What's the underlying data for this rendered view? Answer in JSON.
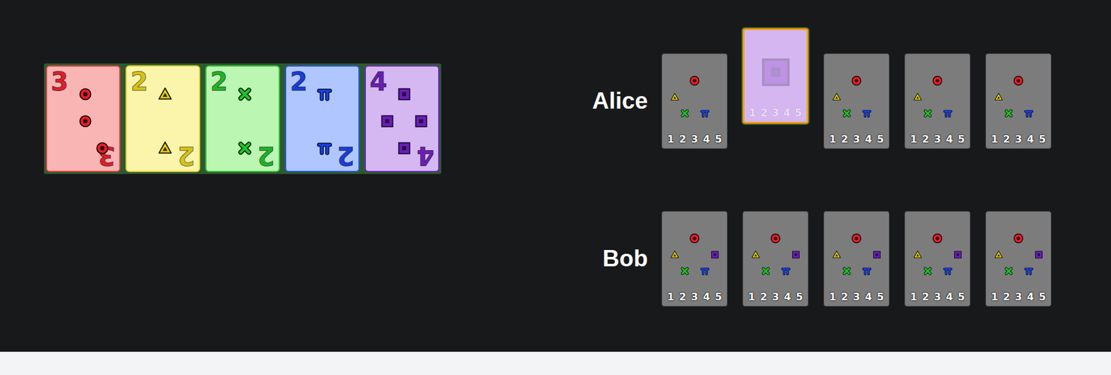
{
  "play_stacks": [
    {
      "suit": "red",
      "rank": "3",
      "color": "#d9202c"
    },
    {
      "suit": "yellow",
      "rank": "2",
      "color": "#d6c21a"
    },
    {
      "suit": "green",
      "rank": "2",
      "color": "#22b22a"
    },
    {
      "suit": "blue",
      "rank": "2",
      "color": "#1a3fd6"
    },
    {
      "suit": "purple",
      "rank": "4",
      "color": "#6a1fb3"
    }
  ],
  "players": [
    {
      "name": "Alice",
      "cards": [
        {
          "kind": "unknown",
          "selected": false,
          "possible_suits": [
            "red",
            "yellow",
            "green",
            "blue"
          ],
          "possible_ranks": [
            "1",
            "2",
            "3",
            "4",
            "5"
          ]
        },
        {
          "kind": "clued",
          "selected": true,
          "possible_suits": [
            "purple"
          ],
          "possible_ranks": [
            "1",
            "2",
            "3",
            "4",
            "5"
          ]
        },
        {
          "kind": "unknown",
          "selected": false,
          "possible_suits": [
            "red",
            "yellow",
            "green",
            "blue"
          ],
          "possible_ranks": [
            "1",
            "2",
            "3",
            "4",
            "5"
          ]
        },
        {
          "kind": "unknown",
          "selected": false,
          "possible_suits": [
            "red",
            "yellow",
            "green",
            "blue"
          ],
          "possible_ranks": [
            "1",
            "2",
            "3",
            "4",
            "5"
          ]
        },
        {
          "kind": "unknown",
          "selected": false,
          "possible_suits": [
            "red",
            "yellow",
            "green",
            "blue"
          ],
          "possible_ranks": [
            "1",
            "2",
            "3",
            "4",
            "5"
          ]
        }
      ]
    },
    {
      "name": "Bob",
      "cards": [
        {
          "kind": "unknown",
          "selected": false,
          "possible_suits": [
            "red",
            "yellow",
            "purple",
            "green",
            "blue"
          ],
          "possible_ranks": [
            "1",
            "2",
            "3",
            "4",
            "5"
          ]
        },
        {
          "kind": "unknown",
          "selected": false,
          "possible_suits": [
            "red",
            "yellow",
            "purple",
            "green",
            "blue"
          ],
          "possible_ranks": [
            "1",
            "2",
            "3",
            "4",
            "5"
          ]
        },
        {
          "kind": "unknown",
          "selected": false,
          "possible_suits": [
            "red",
            "yellow",
            "purple",
            "green",
            "blue"
          ],
          "possible_ranks": [
            "1",
            "2",
            "3",
            "4",
            "5"
          ]
        },
        {
          "kind": "unknown",
          "selected": false,
          "possible_suits": [
            "red",
            "yellow",
            "purple",
            "green",
            "blue"
          ],
          "possible_ranks": [
            "1",
            "2",
            "3",
            "4",
            "5"
          ]
        },
        {
          "kind": "unknown",
          "selected": false,
          "possible_suits": [
            "red",
            "yellow",
            "purple",
            "green",
            "blue"
          ],
          "possible_ranks": [
            "1",
            "2",
            "3",
            "4",
            "5"
          ]
        }
      ]
    }
  ]
}
